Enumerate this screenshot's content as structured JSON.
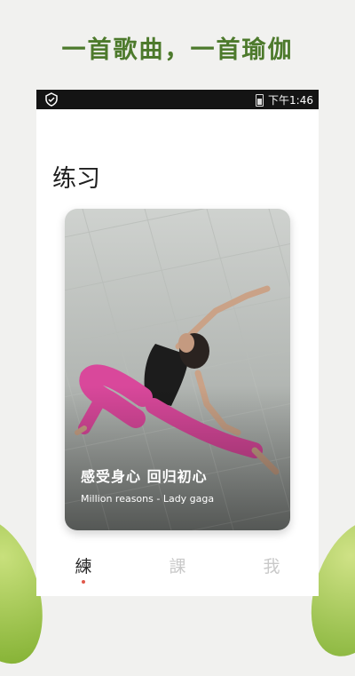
{
  "promo": {
    "title": "一首歌曲，一首瑜伽"
  },
  "status_bar": {
    "time": "下午1:46"
  },
  "page": {
    "heading": "练习"
  },
  "card": {
    "title": "感受身心 回归初心",
    "subtitle": "Million reasons - Lady gaga"
  },
  "tabs": [
    {
      "label": "練",
      "active": true
    },
    {
      "label": "課",
      "active": false
    },
    {
      "label": "我",
      "active": false
    }
  ],
  "colors": {
    "promo_green": "#4d7a2c",
    "status_bar": "#141414",
    "active_tab": "#2a2a2a",
    "inactive_tab": "#c9c9c9",
    "tab_dot": "#e0584b",
    "leggings": "#d9489b"
  },
  "icons": {
    "status_left": "shield-check-icon",
    "battery": "battery-icon"
  }
}
